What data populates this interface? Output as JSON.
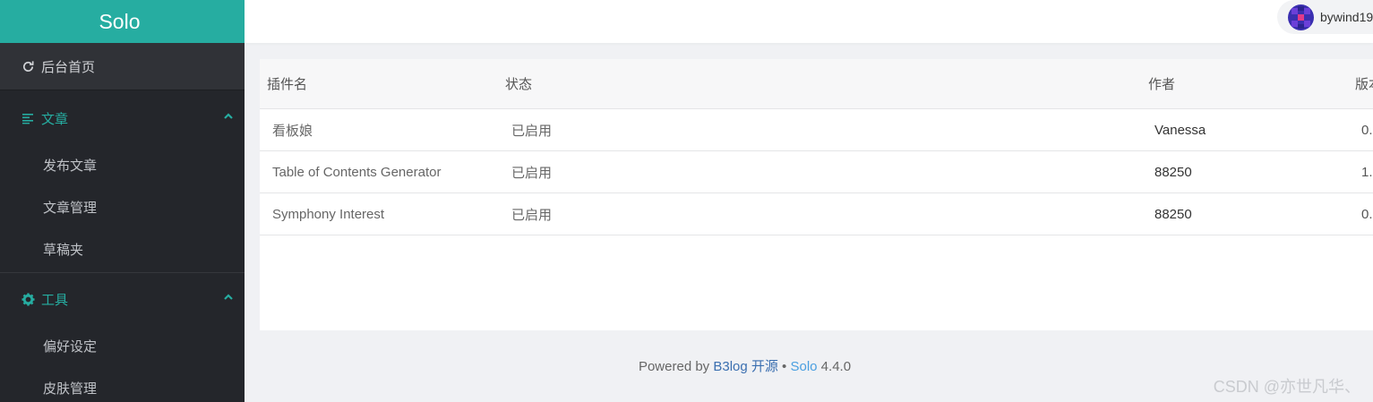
{
  "brand": "Solo",
  "sidebar": {
    "home": {
      "label": "后台首页",
      "icon": "refresh-icon"
    },
    "sections": [
      {
        "label": "文章",
        "icon": "list-icon",
        "expanded": true,
        "items": [
          "发布文章",
          "文章管理",
          "草稿夹"
        ]
      },
      {
        "label": "工具",
        "icon": "gear-icon",
        "expanded": true,
        "items": [
          "偏好设定",
          "皮肤管理"
        ]
      }
    ]
  },
  "header": {
    "username": "bywind19"
  },
  "table": {
    "columns": [
      "插件名",
      "状态",
      "作者",
      "版本"
    ],
    "rows": [
      {
        "name": "看板娘",
        "status": "已启用",
        "author": "Vanessa",
        "version": "0."
      },
      {
        "name": "Table of Contents Generator",
        "status": "已启用",
        "author": "88250",
        "version": "1."
      },
      {
        "name": "Symphony Interest",
        "status": "已启用",
        "author": "88250",
        "version": "0."
      }
    ]
  },
  "footer": {
    "prefix": "Powered by ",
    "b3log": "B3log 开源",
    "sep": " • ",
    "solo": "Solo",
    "version": " 4.4.0"
  },
  "watermark": "CSDN @亦世凡华、",
  "colors": {
    "accent": "#26ada1",
    "sidebar_bg": "#24262b",
    "link": "#3b6fb0"
  }
}
